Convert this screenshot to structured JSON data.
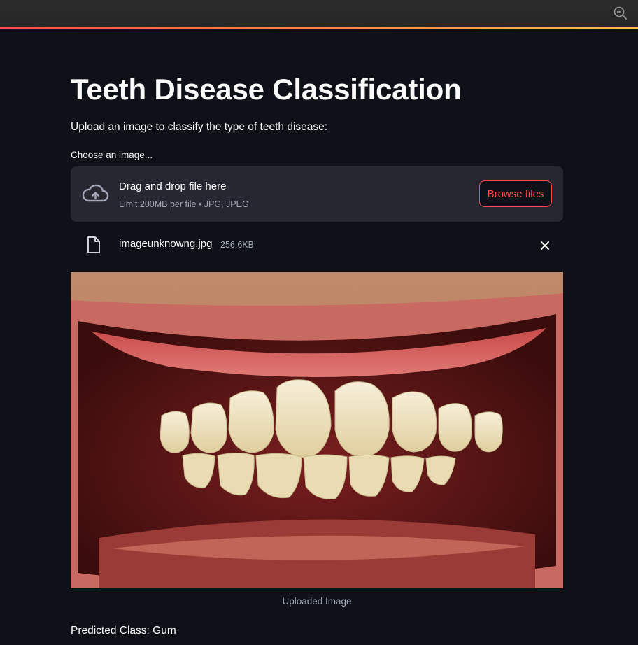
{
  "header": {
    "zoom_icon": "zoom-out-icon"
  },
  "page": {
    "title": "Teeth Disease Classification",
    "subtitle": "Upload an image to classify the type of teeth disease:"
  },
  "uploader": {
    "label": "Choose an image...",
    "dropzone_title": "Drag and drop file here",
    "dropzone_limit": "Limit 200MB per file • JPG, JPEG",
    "browse_label": "Browse files",
    "upload_icon": "cloud-upload-icon",
    "accent_color": "#ff4b4b"
  },
  "uploaded_file": {
    "name": "imageunknowng.jpg",
    "size": "256.6KB",
    "file_icon": "file-icon",
    "remove_icon": "close-icon"
  },
  "image": {
    "caption": "Uploaded Image"
  },
  "result": {
    "label": "Predicted Class:",
    "value": "Gum"
  }
}
